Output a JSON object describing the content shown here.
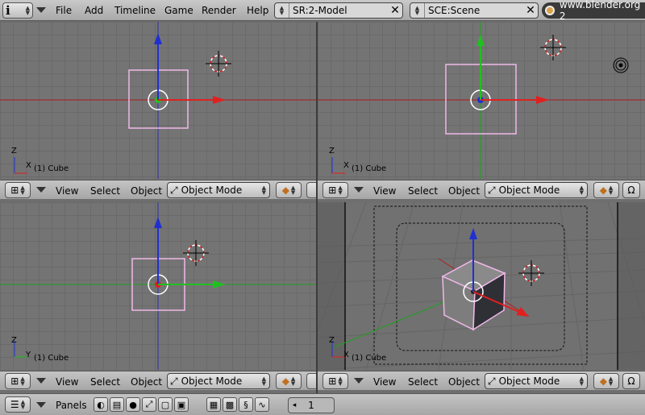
{
  "header": {
    "menus": [
      "File",
      "Add",
      "Timeline",
      "Game",
      "Render",
      "Help"
    ],
    "screen_field": "SR:2-Model",
    "scene_field": "SCE:Scene",
    "url": "www.blender.org 2"
  },
  "viewports": [
    {
      "label": "(1) Cube",
      "axes": [
        "Z",
        "X"
      ]
    },
    {
      "label": "(1) Cube",
      "axes": [
        "Z",
        "X"
      ]
    },
    {
      "label": "(1) Cube",
      "axes": [
        "Z",
        "Y"
      ]
    },
    {
      "label": "(1) Cube",
      "axes": [
        "Z",
        "X"
      ]
    }
  ],
  "view_header": {
    "view": "View",
    "select": "Select",
    "object": "Object",
    "mode": "Object Mode"
  },
  "buttons_window": {
    "panels": "Panels",
    "frame": "1"
  },
  "colors": {
    "x_axis": "#e02020",
    "y_axis": "#20c020",
    "z_axis": "#2030d0",
    "cube_outline": "#f0b8e8"
  }
}
